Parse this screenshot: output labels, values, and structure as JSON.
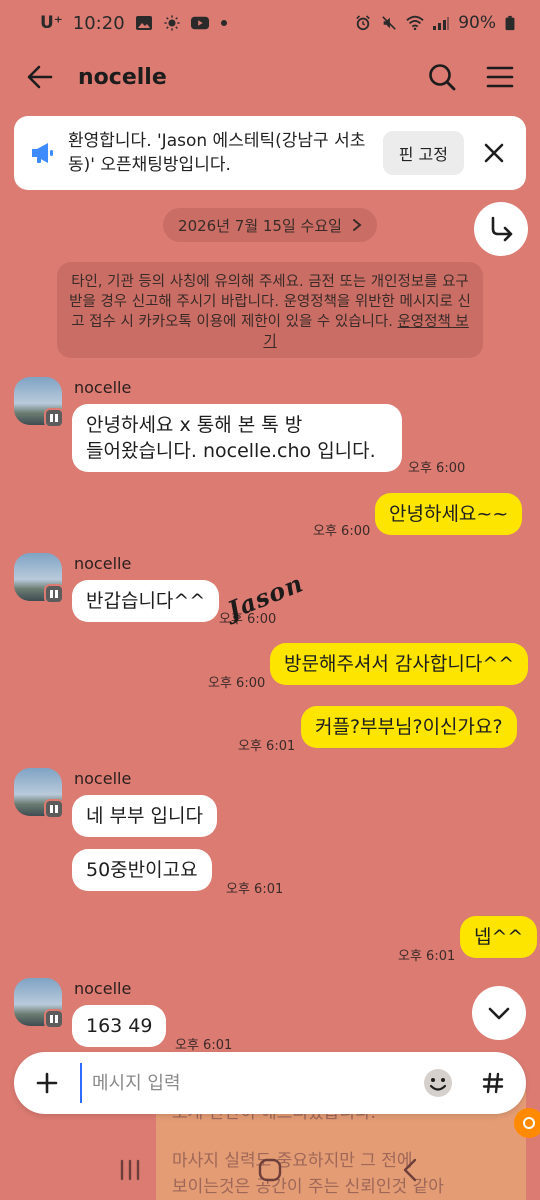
{
  "status_bar": {
    "carrier": "U⁺",
    "time": "10:20",
    "battery": "90%",
    "left_icons": [
      "gallery-icon",
      "brightness-icon",
      "youtube-icon",
      "dot-icon"
    ],
    "right_icons": [
      "alarm-icon",
      "mute-icon",
      "wifi-icon",
      "signal-icon",
      "battery-icon"
    ]
  },
  "app_bar": {
    "title": "nocelle",
    "icons": [
      "back-arrow-icon",
      "search-icon",
      "menu-icon"
    ]
  },
  "notice": {
    "text": "환영합니다. 'Jason 에스테틱(강남구 서초동)' 오픈채팅방입니다.",
    "pin_label": "핀 고정",
    "icon": "megaphone-icon",
    "accent": "#3d8bff"
  },
  "date_divider": {
    "label": "2026년 7월 15일 수요일",
    "icon": "chevron-right-icon"
  },
  "policy": {
    "text": "타인, 기관 등의 사칭에 유의해 주세요. 금전 또는 개인정보를 요구 받을 경우 신고해 주시기 바랍니다. 운영정책을 위반한 메시지로 신고 접수 시 카카오톡 이용에 제한이 있을 수 있습니다.",
    "link": "운영정책 보기"
  },
  "messages": {
    "m1": {
      "sender": "nocelle",
      "line1": "안녕하세요 x 통해 본 톡 방",
      "line2": "들어왔습니다.  nocelle.cho 입니다.",
      "time": "오후 6:00"
    },
    "m2": {
      "text": "안녕하세요~~",
      "time": "오후 6:00"
    },
    "m3": {
      "sender": "nocelle",
      "text": "반갑습니다^^",
      "time": "오후 6:00"
    },
    "m4": {
      "text": "방문해주셔서 감사합니다^^",
      "time": "오후 6:00"
    },
    "m5": {
      "text": "커플?부부님?이신가요?",
      "time": "오후 6:01"
    },
    "m6": {
      "sender": "nocelle",
      "text_a": "네 부부 입니다",
      "text_b": "50중반이고요",
      "time": "오후 6:01"
    },
    "m7": {
      "text": "넵^^",
      "time": "오후 6:01"
    },
    "m8": {
      "sender": "nocelle",
      "text": "163 49",
      "time": "오후 6:01"
    }
  },
  "watermark": "Jason",
  "overlay": {
    "line1": "소개 간단히 해드리겠습니다.",
    "line2": "마사지 실력도 중요하지만 그 전에",
    "line3": "보이는것은 공간이 주는 신뢰인것 같아"
  },
  "input": {
    "placeholder": "메시지 입력"
  },
  "nav_icons": [
    "recent-apps-icon",
    "home-icon",
    "back-icon"
  ],
  "colors": {
    "background": "#db7b72",
    "outgoing": "#fee500",
    "incoming": "#ffffff"
  }
}
